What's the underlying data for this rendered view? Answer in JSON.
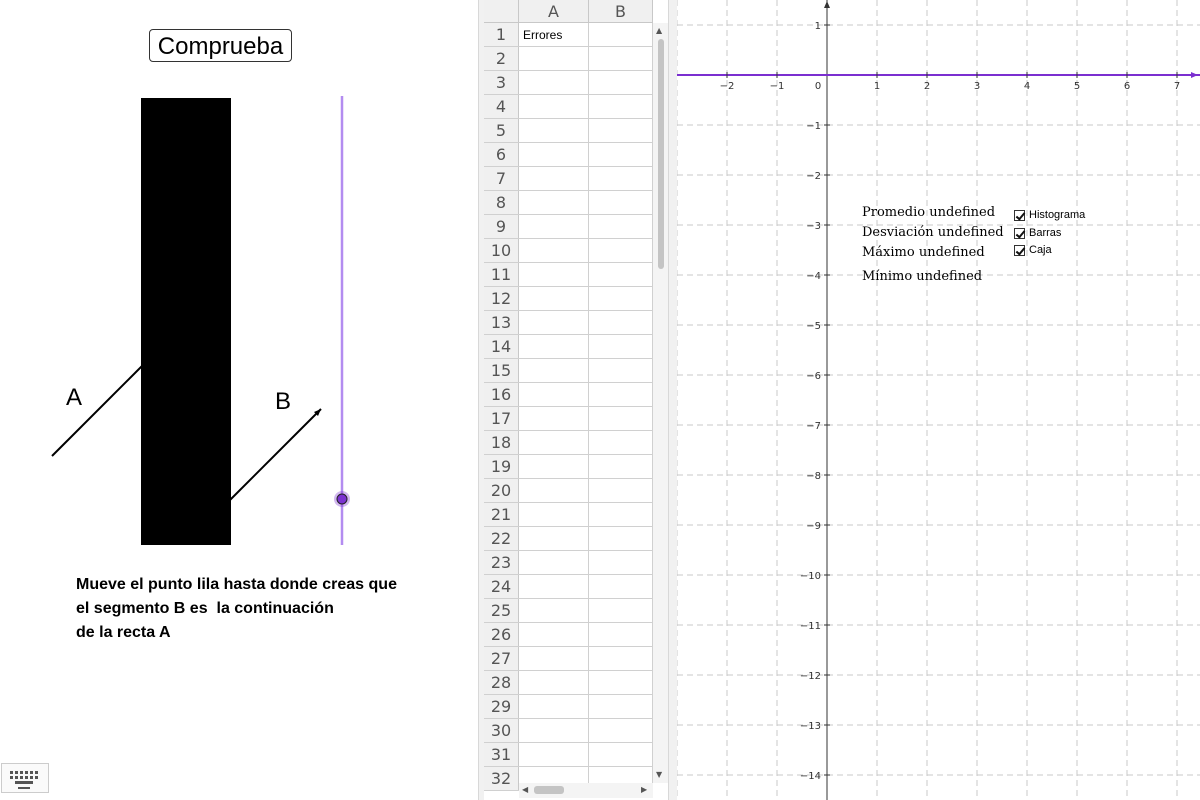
{
  "applet": {
    "check_button_label": "Comprueba",
    "label_a": "A",
    "label_b": "B",
    "instructions": [
      "Mueve el punto lila hasta donde creas que",
      "el segmento B es  la continuación",
      "de la recta A"
    ],
    "slider_color": "#b38cf0",
    "point_color": "#7b32d0"
  },
  "spreadsheet": {
    "columns": [
      "A",
      "B"
    ],
    "rows": [
      "1",
      "2",
      "3",
      "4",
      "5",
      "6",
      "7",
      "8",
      "9",
      "10",
      "11",
      "12",
      "13",
      "14",
      "15",
      "16",
      "17",
      "18",
      "19",
      "20",
      "21",
      "22",
      "23",
      "24",
      "25",
      "26",
      "27",
      "28",
      "29",
      "30",
      "31",
      "32"
    ],
    "cells": {
      "A1": "Errores"
    }
  },
  "graphics": {
    "x_ticks": [
      "−2",
      "−1",
      "0",
      "1",
      "2",
      "3",
      "4",
      "5",
      "6",
      "7"
    ],
    "y_ticks": [
      "1",
      "−1",
      "−2",
      "−3",
      "−4",
      "−5",
      "−6",
      "−7",
      "−8",
      "−9",
      "−10",
      "−11",
      "−12",
      "−13",
      "−14"
    ],
    "line_color": "#7b2fd0",
    "stats": [
      "Promedio undefined",
      "Desviación undefined",
      "Máximo undefined",
      "Mínimo undefined"
    ],
    "checkboxes": [
      {
        "label": "Histograma",
        "checked": true
      },
      {
        "label": "Barras",
        "checked": true
      },
      {
        "label": "Caja",
        "checked": true
      }
    ]
  }
}
